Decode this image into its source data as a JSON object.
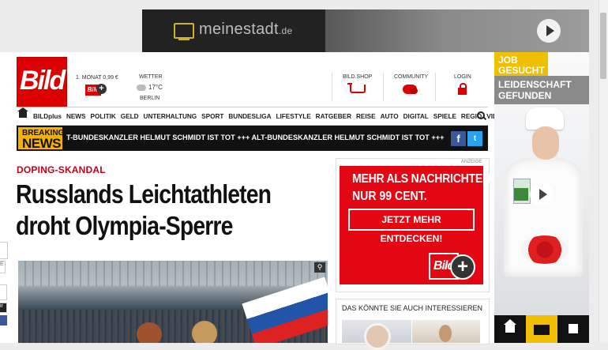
{
  "top_ad": {
    "brand": "meinestadt",
    "brand_tld": ".de"
  },
  "header": {
    "logo": "Bild",
    "monat": "1. MONAT 0,99 €",
    "bild_plus_badge": "Bild",
    "wetter_label": "WETTER",
    "temperature": "17°C",
    "city": "BERLIN",
    "shop_label": "BILD.SHOP",
    "community_label": "COMMUNITY",
    "login_label": "LOGIN"
  },
  "nav": {
    "items": [
      "BILDplus",
      "NEWS",
      "POLITIK",
      "GELD",
      "UNTERHALTUNG",
      "SPORT",
      "BUNDESLIGA",
      "LIFESTYLE",
      "RATGEBER",
      "REISE",
      "AUTO",
      "DIGITAL",
      "SPIELE",
      "REGIO",
      "VIDEO"
    ]
  },
  "breaking": {
    "label_top": "BREAKING",
    "label_bottom": "NEWS",
    "ticker": "T-BUNDESKANZLER HELMUT SCHMIDT IST TOT +++ ALT-BUNDESKANZLER HELMUT SCHMIDT IST TOT +++ ALT-BUI",
    "facebook": "f",
    "twitter": "t"
  },
  "article": {
    "kicker": "DOPING-SKANDAL",
    "headline": "Russlands Leichtathleten droht Olympia-Sperre"
  },
  "left_widget": {
    "e_label": "E",
    "ir_label": "ir"
  },
  "ad": {
    "anzeige": "ANZEIGE",
    "line1": "MEHR ALS NACHRICHTEN!",
    "line2": "NUR 99 CENT.",
    "cta": "JETZT MEHR ENTDECKEN!",
    "logo": "Bild"
  },
  "related": {
    "title": "DAS KÖNNTE SIE AUCH INTERESSIEREN"
  },
  "sky_ad": {
    "job1": "JOB",
    "job2": "GESUCHT",
    "line1": "LEIDENSCHAFT",
    "line2": "GEFUNDEN"
  },
  "colors": {
    "bild_red": "#dd0000",
    "breaking_yellow": "#f7b200",
    "facebook": "#3b5998",
    "twitter": "#2aa3ef"
  }
}
